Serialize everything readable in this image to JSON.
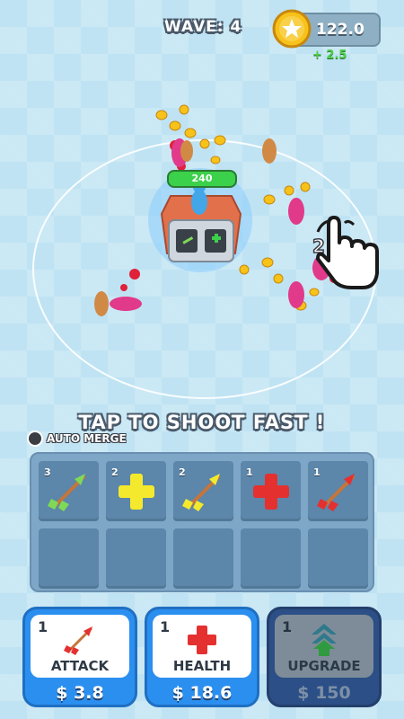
{
  "hud": {
    "wave_label": "WAVE: 4",
    "coins": "122.0",
    "income": "+ 2.5"
  },
  "scene": {
    "tower_hp": "240",
    "tower_slot_label": "2"
  },
  "hint": "TAP TO SHOOT FAST !",
  "auto_merge_label": "AUTO MERGE",
  "merge_grid": {
    "slots": [
      {
        "level": "3",
        "item": "arrow-icon",
        "color": "#7ed957"
      },
      {
        "level": "2",
        "item": "plus-icon",
        "color": "#f4e92c"
      },
      {
        "level": "2",
        "item": "arrow-icon",
        "color": "#f4e92c"
      },
      {
        "level": "1",
        "item": "plus-icon",
        "color": "#e53030"
      },
      {
        "level": "1",
        "item": "arrow-icon",
        "color": "#e53030"
      },
      {
        "level": "",
        "item": ""
      },
      {
        "level": "",
        "item": ""
      },
      {
        "level": "",
        "item": ""
      },
      {
        "level": "",
        "item": ""
      },
      {
        "level": "",
        "item": ""
      }
    ]
  },
  "upgrades": {
    "attack": {
      "count": "1",
      "name": "ATTACK",
      "price": "$ 3.8"
    },
    "health": {
      "count": "1",
      "name": "HEALTH",
      "price": "$ 18.6"
    },
    "upgrade": {
      "count": "1",
      "name": "UPGRADE",
      "price": "$ 150"
    }
  },
  "colors": {
    "accent_blue": "#2b8ff0",
    "health_green": "#3bd14b",
    "coin_gold": "#f7c21a"
  }
}
